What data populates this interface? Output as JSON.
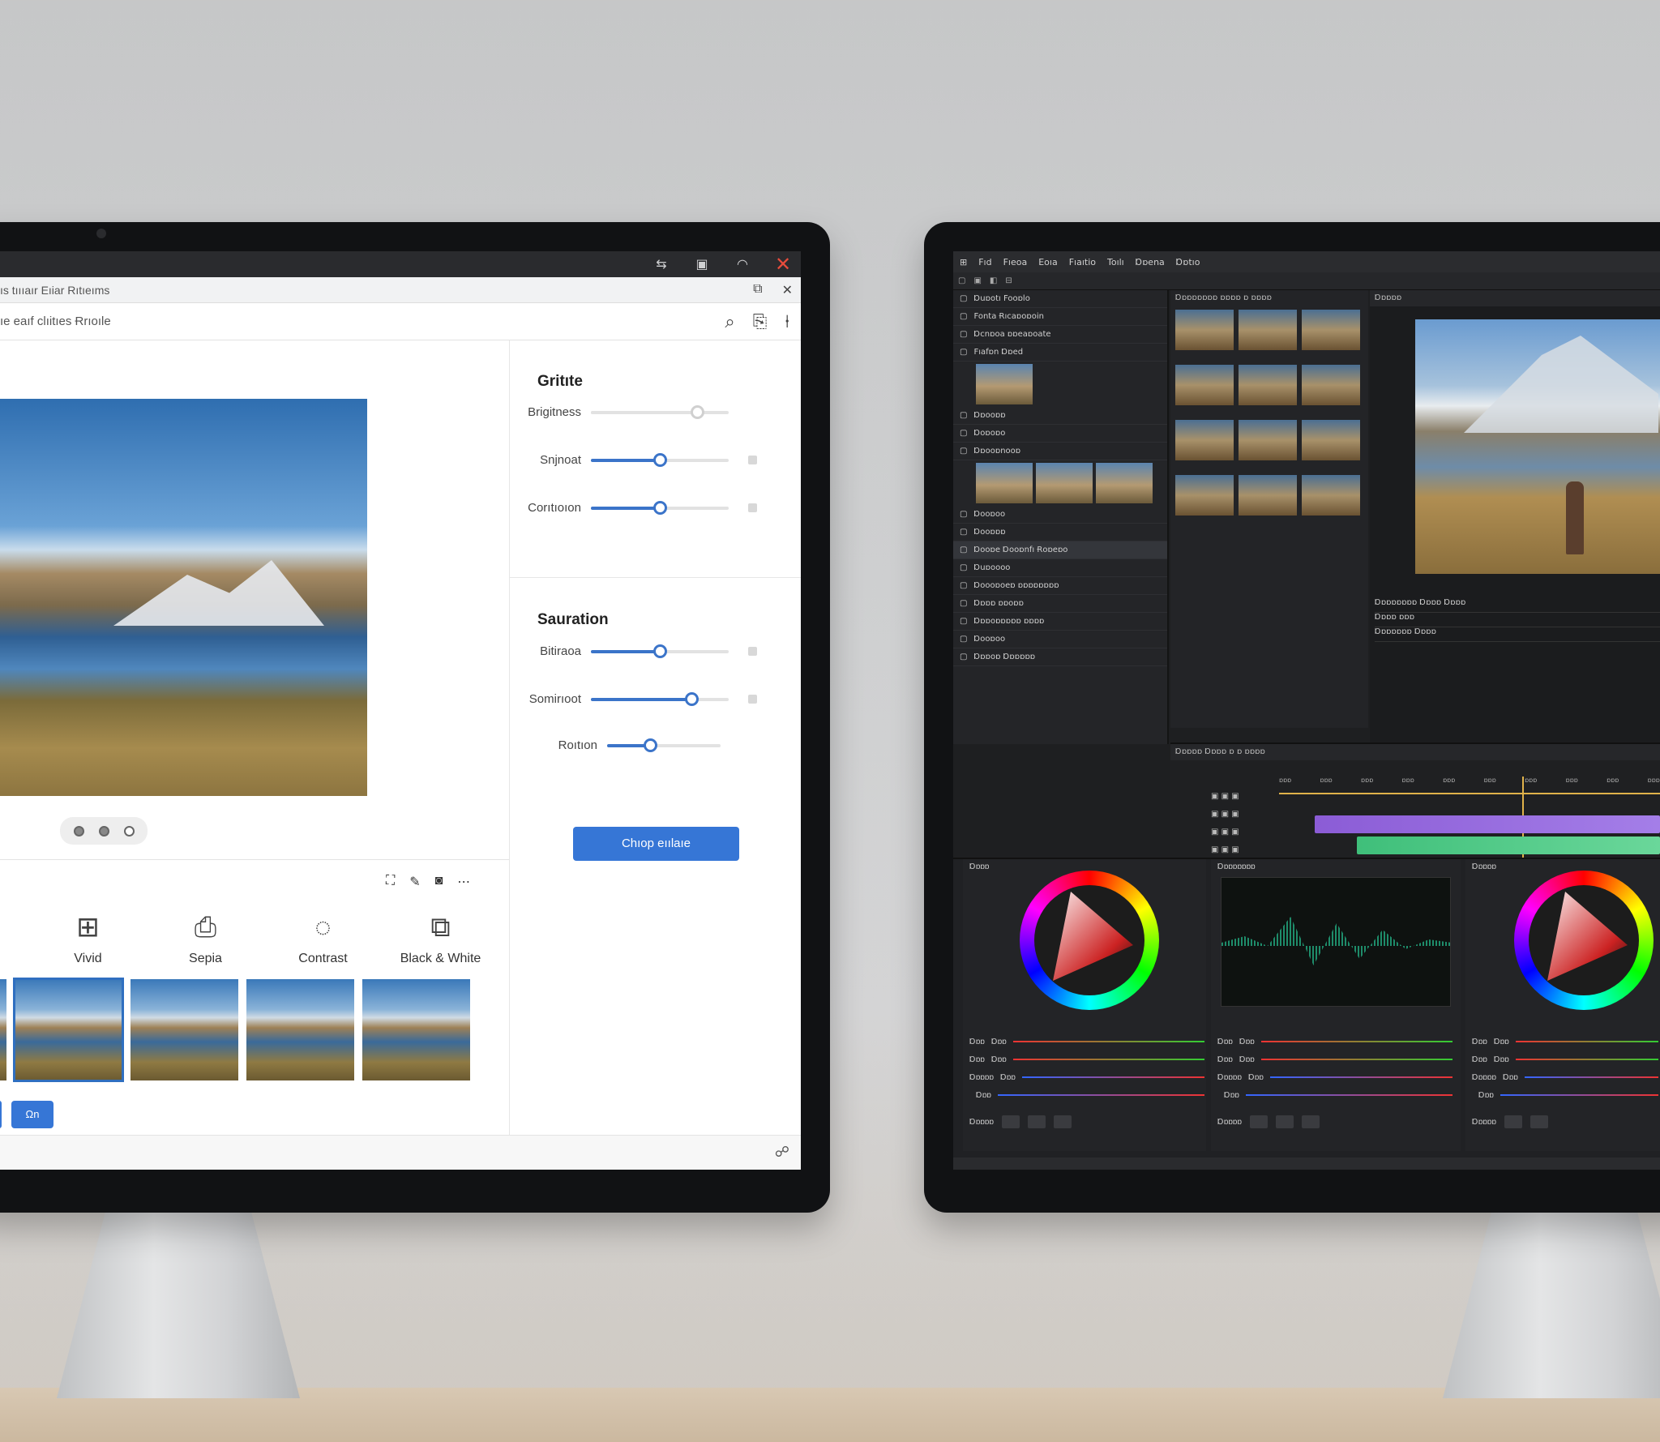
{
  "left_app": {
    "title": "ıs tıııaır Eıiar Rıtıeıms",
    "subtitle": "ıe eaıf clıitıes Ɍrıoıle",
    "photo_label": "Lake landscape",
    "filters": [
      {
        "icon": "grid-icon",
        "label": "Vivid"
      },
      {
        "icon": "sepia-icon",
        "label": "Sepia"
      },
      {
        "icon": "contrast-icon",
        "label": "Contrast"
      },
      {
        "icon": "bw-icon",
        "label": "Black & White"
      }
    ],
    "ok_label": "Ωn",
    "sections": [
      {
        "title": "Gritıte",
        "sliders": [
          {
            "label": "Brigitness",
            "value": 0.77,
            "dim": true
          },
          {
            "label": "Snjnoat",
            "value": 0.5
          },
          {
            "label": "Corıtıoıon",
            "value": 0.5
          }
        ]
      },
      {
        "title": "Sauration",
        "sliders": [
          {
            "label": "Bitiraoa",
            "value": 0.5
          },
          {
            "label": "Somirıoot",
            "value": 0.73
          },
          {
            "label": "Roıtıon",
            "value": 0.38
          }
        ]
      }
    ],
    "apply_label": "Chıop eıılaıe"
  },
  "right_app": {
    "menu": [
      "Fıd",
      "Fıeoa",
      "Eoıa",
      "Fıaıtio",
      "Toılı",
      "Ɒɒena",
      "Ɒɒtıo"
    ],
    "left_rows": [
      {
        "label": "Ɒuɒotı  Fooɒlo"
      },
      {
        "label": "Fonta Ɍıcaɒoɒoin"
      },
      {
        "label": "Ɒcnɒoa ɒɒeaɒoate"
      },
      {
        "label": "Fıafɒn  Ɒɒed"
      },
      {
        "label": "Ɒɒooɒɒ"
      },
      {
        "label": "Ɒoɒoɒo"
      },
      {
        "label": "Ɒɒooɒnooɒ"
      },
      {
        "label": "Ɒooɒoo"
      },
      {
        "label": "Ɒooɒɒɒ"
      },
      {
        "label": "Ɒooɒe Ɒooɒnfı Ɍoɒeɒo",
        "hl": true
      },
      {
        "label": "Ɒuɒoooo"
      },
      {
        "label": "Ɒoooɒoeɒ ɒɒɒɒɒɒɒɒ"
      },
      {
        "label": "Ɒɒɒɒ ɒɒoɒɒ"
      },
      {
        "label": "Ɒɒɒoɒɒɒɒɒ ɒɒɒɒ"
      },
      {
        "label": "Ɒooɒoo"
      },
      {
        "label": "Ɒɒɒoɒ Ɒɒɒɒɒɒ"
      }
    ],
    "media_header": "Ɒɒɒɒɒɒɒɒ ɒɒɒɒ ɒ ɒɒɒɒ",
    "viewer_header": "Ɒɒɒɒɒ",
    "viewer_info": [
      "Ɒɒɒɒɒɒɒɒ Ɒɒɒɒ  Ɒɒɒɒ",
      "Ɒɒɒɒ ɒɒɒ",
      "Ɒɒɒɒɒɒɒ  Ɒɒɒɒ"
    ],
    "timeline_header": "Ɒɒɒɒɒ  Ɒɒɒɒ ɒ ɒ  ɒɒɒɒ",
    "ruler": [
      "ɒɒɒ",
      "ɒɒɒ",
      "ɒɒɒ",
      "ɒɒɒ",
      "ɒɒɒ",
      "ɒɒɒ",
      "ɒɒɒ",
      "ɒɒɒ",
      "ɒɒɒ",
      "ɒɒɒ"
    ],
    "panels": [
      {
        "title": "Ɒɒɒɒ"
      },
      {
        "title": "Ɒɒɒɒɒɒɒɒ"
      },
      {
        "title": "Ɒɒɒɒɒ"
      }
    ],
    "panel_rows": [
      {
        "label": "Ɒɒɒ",
        "v": "Ɒɒɒ"
      },
      {
        "label": "Ɒɒɒ",
        "v": "Ɒɒɒ"
      },
      {
        "label": "Ɒɒɒɒɒ",
        "v": "Ɒɒɒ"
      },
      {
        "label": "",
        "v": "Ɒɒɒ"
      }
    ],
    "panel_foot": "Ɒɒɒɒɒ"
  }
}
